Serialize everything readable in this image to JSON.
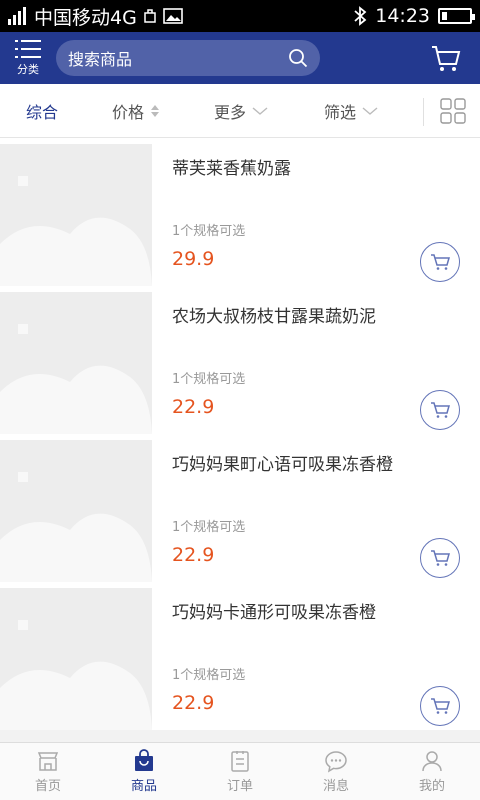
{
  "status": {
    "carrier": "中国移动4G",
    "time": "14:23",
    "battery_level": 0.2,
    "icons": [
      "signal-icon",
      "screenshot-icon",
      "image-icon",
      "bluetooth-icon",
      "battery-icon"
    ]
  },
  "header": {
    "category_label": "分类",
    "search_placeholder": "搜索商品",
    "icons": [
      "menu-icon",
      "search-icon",
      "cart-icon"
    ]
  },
  "filters": [
    {
      "label": "综合",
      "active": true
    },
    {
      "label": "价格",
      "icon": "sort-icon"
    },
    {
      "label": "更多",
      "icon": "chevron-down-icon"
    },
    {
      "label": "筛选",
      "icon": "chevron-down-icon"
    }
  ],
  "products": [
    {
      "name": "蒂芙莱香蕉奶露",
      "spec": "1个规格可选",
      "price": "29.9"
    },
    {
      "name": "农场大叔杨枝甘露果蔬奶泥",
      "spec": "1个规格可选",
      "price": "22.9"
    },
    {
      "name": "巧妈妈果町心语可吸果冻香橙",
      "spec": "1个规格可选",
      "price": "22.9"
    },
    {
      "name": "巧妈妈卡通形可吸果冻香橙",
      "spec": "1个规格可选",
      "price": "22.9"
    }
  ],
  "nav": [
    {
      "label": "首页",
      "icon": "home-icon"
    },
    {
      "label": "商品",
      "icon": "bag-icon",
      "active": true
    },
    {
      "label": "订单",
      "icon": "order-icon"
    },
    {
      "label": "消息",
      "icon": "message-icon"
    },
    {
      "label": "我的",
      "icon": "user-icon"
    }
  ],
  "colors": {
    "primary": "#23398f",
    "price": "#e5541f"
  }
}
